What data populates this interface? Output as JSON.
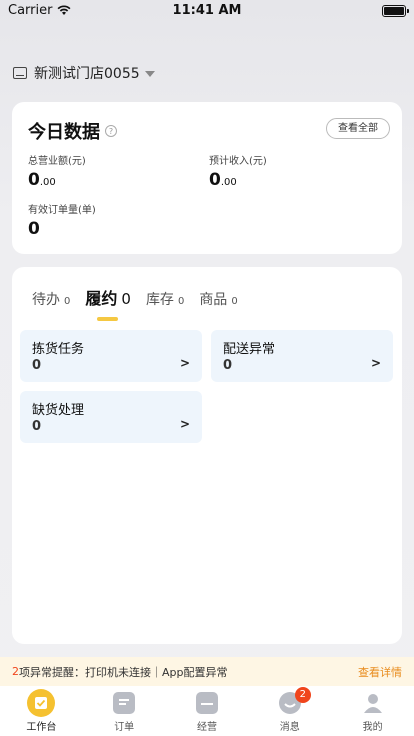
{
  "status_bar": {
    "carrier": "Carrier",
    "time": "11:41 AM"
  },
  "store": {
    "name": "新测试门店0055"
  },
  "today": {
    "title": "今日数据",
    "help": "?",
    "view_all": "查看全部",
    "metrics": [
      {
        "label": "总营业额(元)",
        "int": "0",
        "dec": ".00"
      },
      {
        "label": "预计收入(元)",
        "int": "0",
        "dec": ".00"
      },
      {
        "label": "有效订单量(单)",
        "int": "0",
        "dec": ""
      }
    ]
  },
  "tabs": [
    {
      "label": "待办",
      "count": "0"
    },
    {
      "label": "履约",
      "count": "0"
    },
    {
      "label": "库存",
      "count": "0"
    },
    {
      "label": "商品",
      "count": "0"
    }
  ],
  "tasks": [
    {
      "title": "拣货任务",
      "count": "0",
      "chevron": ">"
    },
    {
      "title": "配送异常",
      "count": "0",
      "chevron": ">"
    },
    {
      "title": "缺货处理",
      "count": "0",
      "chevron": ">"
    }
  ],
  "alert": {
    "count": "2",
    "message": "项异常提醒：打印机未连接｜App配置异常",
    "details": "查看详情"
  },
  "tabbar": {
    "items": [
      {
        "label": "工作台",
        "icon": "workbench-icon"
      },
      {
        "label": "订单",
        "icon": "orders-icon"
      },
      {
        "label": "经营",
        "icon": "business-icon"
      },
      {
        "label": "消息",
        "icon": "message-icon",
        "badge": "2"
      },
      {
        "label": "我的",
        "icon": "profile-icon"
      }
    ]
  },
  "colors": {
    "accent": "#f5c130",
    "alert_red": "#f0451c",
    "link_orange": "#e88b1c",
    "task_bg": "#eef5fc"
  }
}
